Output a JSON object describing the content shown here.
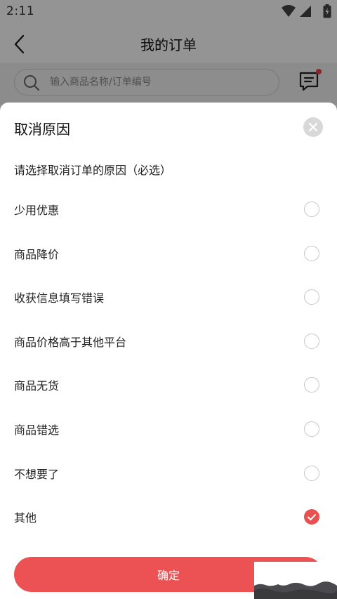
{
  "status_bar": {
    "time": "2:11",
    "icons": [
      "wifi-icon",
      "signal-icon",
      "battery-charging-icon"
    ]
  },
  "header": {
    "title": "我的订单",
    "back_icon": "chevron-left-icon"
  },
  "search": {
    "placeholder": "输入商品名称/订单编号",
    "icon": "search-icon"
  },
  "message": {
    "icon": "message-icon",
    "has_unread_badge": true,
    "badge_color": "#e8474c"
  },
  "sheet": {
    "title": "取消原因",
    "close_icon": "close-icon",
    "subtitle": "请选择取消订单的原因（必选）",
    "reasons": [
      {
        "label": "少用优惠",
        "selected": false
      },
      {
        "label": "商品降价",
        "selected": false
      },
      {
        "label": "收获信息填写错误",
        "selected": false
      },
      {
        "label": "商品价格高于其他平台",
        "selected": false
      },
      {
        "label": "商品无货",
        "selected": false
      },
      {
        "label": "商品错选",
        "selected": false
      },
      {
        "label": "不想要了",
        "selected": false
      },
      {
        "label": "其他",
        "selected": true
      }
    ],
    "confirm_label": "确定"
  },
  "colors": {
    "accent": "#ec5254",
    "overlay": "rgba(0,0,0,0.42)"
  }
}
